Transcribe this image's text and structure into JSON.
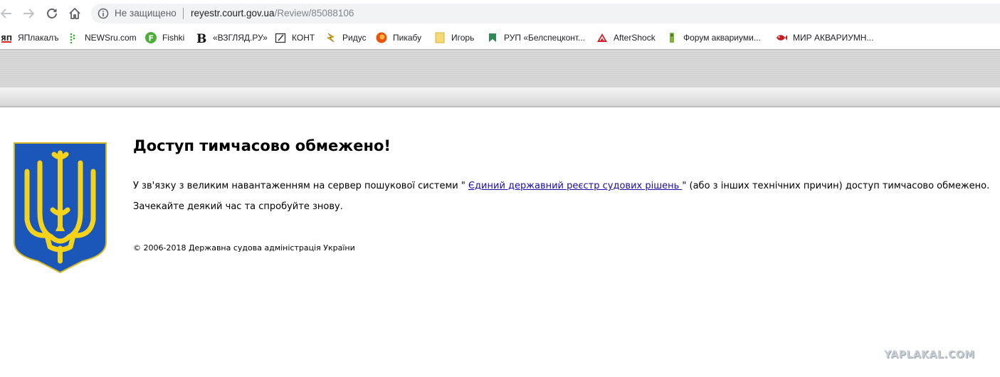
{
  "browser": {
    "security_label": "Не защищено",
    "url_host": "reyestr.court.gov.ua",
    "url_path": "/Review/85088106",
    "icons": [
      "back-arrow-icon",
      "forward-arrow-icon",
      "reload-icon",
      "home-icon",
      "info-icon"
    ]
  },
  "bookmarks": [
    {
      "label": "ЯПлакалъ",
      "icon": "yaplakal-favicon"
    },
    {
      "label": "NEWSru.com",
      "icon": "newsru-favicon"
    },
    {
      "label": "Fishki",
      "icon": "fishki-favicon"
    },
    {
      "label": "«ВЗГЛЯД.РУ»",
      "icon": "vzglyad-favicon"
    },
    {
      "label": "КОНТ",
      "icon": "kont-favicon"
    },
    {
      "label": "Ридус",
      "icon": "ridus-favicon"
    },
    {
      "label": "Пикабу",
      "icon": "pikabu-favicon"
    },
    {
      "label": "Игорь",
      "icon": "folder-icon"
    },
    {
      "label": "РУП «Белспецконт...",
      "icon": "bookmark-flag-icon"
    },
    {
      "label": "AfterShock",
      "icon": "aftershock-favicon"
    },
    {
      "label": "Форум аквариуми...",
      "icon": "aquarium-forum-favicon"
    },
    {
      "label": "МИР АКВАРИУМН...",
      "icon": "fish-favicon"
    }
  ],
  "page": {
    "title": "Доступ тимчасово обмежено!",
    "message_before": "У зв'язку з великим навантаженням на сервер пошукової системи \" ",
    "message_link": "Єдиний державний реєстр судових рішень ",
    "message_after": "\" (або з інших технічних причин) доступ тимчасово обмежено.",
    "retry_text": "Зачекайте деякий час та спробуйте знову.",
    "copyright": "© 2006-2018 Державна судова адміністрація України",
    "emblem": "ukraine-coat-of-arms"
  },
  "colors": {
    "link": "#1a0dab",
    "shield_blue": "#1b57b8",
    "trident_gold": "#f5d31a"
  },
  "watermark": "YAPLAKAL.COM"
}
